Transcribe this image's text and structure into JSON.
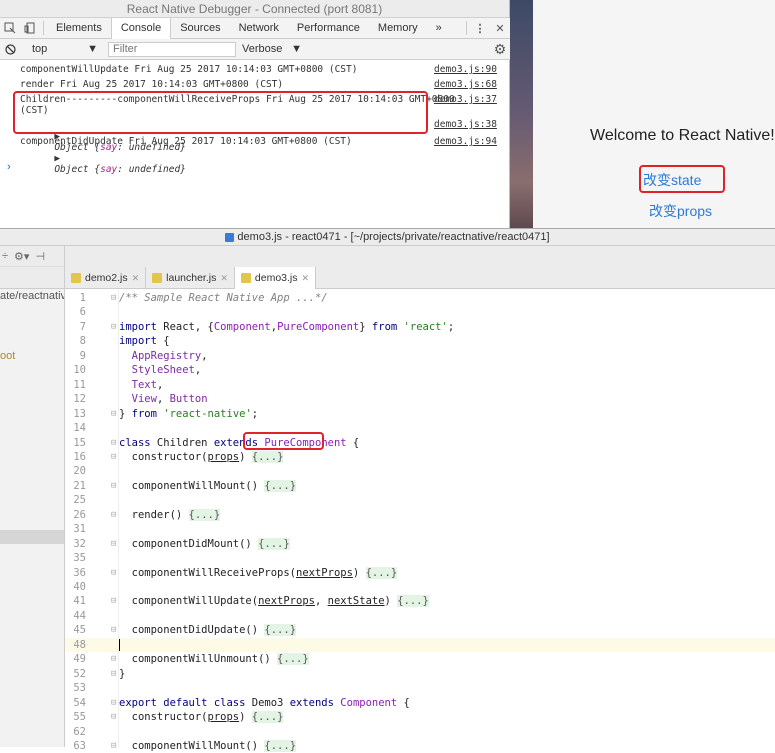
{
  "devtools": {
    "window_title": "React Native Debugger - Connected (port 8081)",
    "tabs": [
      "Elements",
      "Console",
      "Sources",
      "Network",
      "Performance",
      "Memory"
    ],
    "active_tab": "Console",
    "more_tabs": "»",
    "context": "top",
    "filter_placeholder": "Filter",
    "level": "Verbose",
    "logs": [
      {
        "text": "componentWillUpdate Fri Aug 25 2017 10:14:03 GMT+0800 (CST)",
        "source": "demo3.js:90"
      },
      {
        "text": "render Fri Aug 25 2017 10:14:03 GMT+0800 (CST)",
        "source": "demo3.js:68"
      },
      {
        "text": "Children---------componentWillReceiveProps Fri Aug 25 2017 10:14:03 GMT+0800",
        "text2": "(CST)",
        "source": "demo3.js:37"
      },
      {
        "obj1": "Object {",
        "key": "say",
        "val": ": undefined}",
        "source": "demo3.js:38"
      },
      {
        "text": "componentDidUpdate Fri Aug 25 2017 10:14:03 GMT+0800 (CST)",
        "source": "demo3.js:94"
      }
    ],
    "prompt": "›"
  },
  "simulator": {
    "welcome": "Welcome to React Native!",
    "state_button": "改变state",
    "props_button": "改变props",
    "highlight_color": "#e0222b"
  },
  "ide": {
    "window_title": "demo3.js - react0471 - [~/projects/private/reactnative/react0471]",
    "left_path": "ate/reactnativ",
    "left_item": "oot",
    "tabs": [
      "demo2.js",
      "launcher.js",
      "demo3.js"
    ],
    "active_tab": "demo3.js"
  },
  "code_lines": [
    {
      "n": "1",
      "html": "<span class='cmt'>/** Sample React Native App ...*/</span>"
    },
    {
      "n": "6",
      "html": ""
    },
    {
      "n": "7",
      "html": "<span class='kw'>import</span> React, {<span class='cls'>Component</span>,<span class='cls'>PureComponent</span>} <span class='kw'>from</span> <span class='str'>'react'</span>;"
    },
    {
      "n": "8",
      "html": "<span class='kw'>import</span> {"
    },
    {
      "n": "9",
      "html": "  <span class='prop'>AppRegistry</span>,"
    },
    {
      "n": "10",
      "html": "  <span class='prop'>StyleSheet</span>,"
    },
    {
      "n": "11",
      "html": "  <span class='prop'>Text</span>,"
    },
    {
      "n": "12",
      "html": "  <span class='prop'>View</span>, <span class='prop'>Button</span>"
    },
    {
      "n": "13",
      "html": "} <span class='kw'>from</span> <span class='str'>'react-native'</span>;"
    },
    {
      "n": "14",
      "html": ""
    },
    {
      "n": "15",
      "html": "<span class='kw'>class</span> Children <span class='kw'>extends</span> <span class='cls'>PureComponent</span> {"
    },
    {
      "n": "16",
      "html": "  constructor(<span class='ul'>props</span>) <span class='fold'>{...}</span>"
    },
    {
      "n": "20",
      "html": ""
    },
    {
      "n": "21",
      "html": "  componentWillMount() <span class='fold'>{...}</span>"
    },
    {
      "n": "25",
      "html": ""
    },
    {
      "n": "26",
      "html": "  render() <span class='fold'>{...}</span>"
    },
    {
      "n": "31",
      "html": ""
    },
    {
      "n": "32",
      "html": "  componentDidMount() <span class='fold'>{...}</span>"
    },
    {
      "n": "35",
      "html": ""
    },
    {
      "n": "36",
      "html": "  componentWillReceiveProps(<span class='ul'>nextProps</span>) <span class='fold'>{...}</span>"
    },
    {
      "n": "40",
      "html": ""
    },
    {
      "n": "41",
      "html": "  componentWillUpdate(<span class='ul'>nextProps</span>, <span class='ul'>nextState</span>) <span class='fold'>{...}</span>"
    },
    {
      "n": "44",
      "html": ""
    },
    {
      "n": "45",
      "html": "  componentDidUpdate() <span class='fold'>{...}</span>"
    },
    {
      "n": "48",
      "html": "",
      "current": true
    },
    {
      "n": "49",
      "html": "  componentWillUnmount() <span class='fold'>{...}</span>"
    },
    {
      "n": "52",
      "html": "}"
    },
    {
      "n": "53",
      "html": ""
    },
    {
      "n": "54",
      "html": "<span class='kw'>export default class</span> Demo3 <span class='kw'>extends</span> <span class='cls'>Component</span> {"
    },
    {
      "n": "55",
      "html": "  constructor(<span class='ul'>props</span>) <span class='fold'>{...}</span>"
    },
    {
      "n": "62",
      "html": ""
    },
    {
      "n": "63",
      "html": "  componentWillMount() <span class='fold'>{...}</span>"
    }
  ]
}
